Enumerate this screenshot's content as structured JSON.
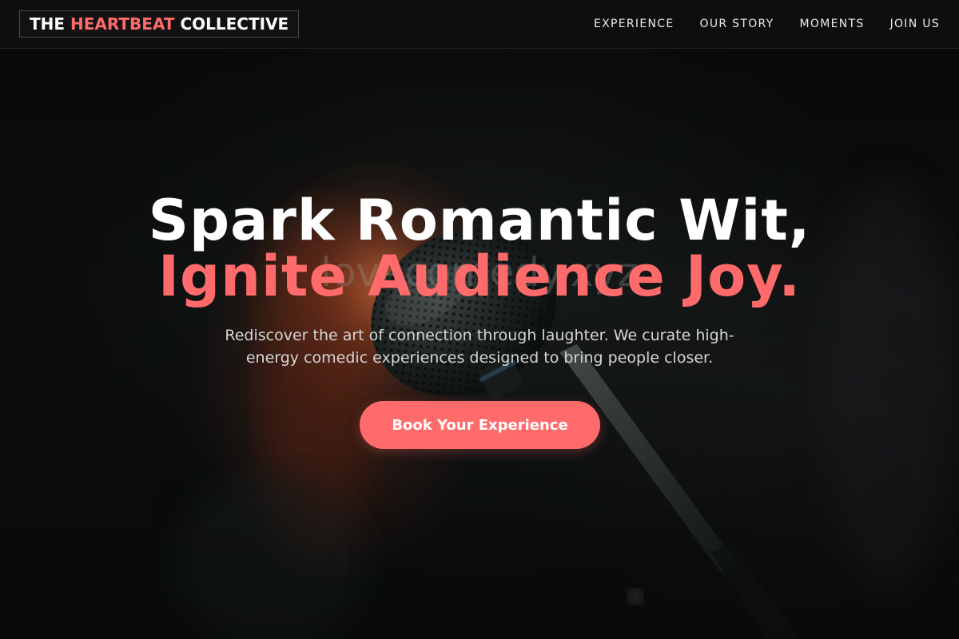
{
  "brand": {
    "prefix": "THE ",
    "accent": "HEARTBEAT",
    "suffix": " COLLECTIVE"
  },
  "nav": {
    "items": [
      {
        "label": "EXPERIENCE"
      },
      {
        "label": "OUR STORY"
      },
      {
        "label": "MOMENTS"
      },
      {
        "label": "JOIN US"
      }
    ]
  },
  "hero": {
    "headline_line1": "Spark Romantic Wit,",
    "headline_line2": "Ignite Audience Joy.",
    "subtitle": "Rediscover the art of connection through laughter. We curate high-energy comedic experiences designed to bring people closer.",
    "cta_label": "Book Your Experience",
    "watermark": "lovecomedy.xyz",
    "background_image": "microphone-on-stand"
  },
  "colors": {
    "accent": "#ff6b6b",
    "header_bg": "#0e0e0e",
    "page_bg": "#0c0d0d",
    "text_primary": "#ffffff",
    "text_secondary": "#d6d6d6"
  }
}
